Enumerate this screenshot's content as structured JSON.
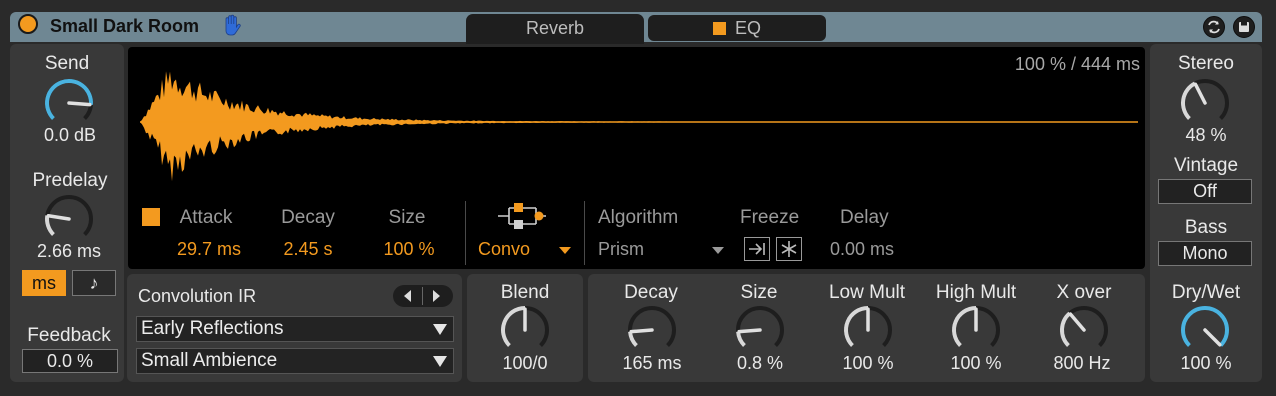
{
  "device": {
    "name": "Small Dark Room",
    "accent": "#f39a1f"
  },
  "tabs": [
    {
      "label": "Reverb"
    },
    {
      "label": "EQ"
    }
  ],
  "left": {
    "send": {
      "label": "Send",
      "value": "0.0 dB",
      "level": 0.85
    },
    "predelay": {
      "label": "Predelay",
      "value": "2.66 ms",
      "level": 0.2
    },
    "unit_ms": "ms",
    "unit_note": "♪",
    "feedback": {
      "label": "Feedback",
      "value": "0.0 %"
    }
  },
  "display": {
    "readout": "100 % / 444 ms",
    "attack": {
      "label": "Attack",
      "value": "29.7 ms"
    },
    "decay": {
      "label": "Decay",
      "value": "2.45 s"
    },
    "size": {
      "label": "Size",
      "value": "100 %"
    },
    "mode": "Convo",
    "algorithm": {
      "label": "Algorithm",
      "value": "Prism"
    },
    "freeze": {
      "label": "Freeze"
    },
    "delay": {
      "label": "Delay",
      "value": "0.00 ms"
    }
  },
  "ir": {
    "label": "Convolution IR",
    "category": "Early Reflections",
    "file": "Small Ambience"
  },
  "blend": {
    "label": "Blend",
    "value": "100/0",
    "level": 0.5
  },
  "bottom": {
    "decay": {
      "label": "Decay",
      "value": "165 ms",
      "level": 0.15
    },
    "size": {
      "label": "Size",
      "value": "0.8 %",
      "level": 0.15
    },
    "low_mult": {
      "label": "Low Mult",
      "value": "100 %",
      "level": 0.5
    },
    "high_mult": {
      "label": "High Mult",
      "value": "100 %",
      "level": 0.5
    },
    "xover": {
      "label": "X over",
      "value": "800 Hz",
      "level": 0.35
    }
  },
  "right": {
    "stereo": {
      "label": "Stereo",
      "value": "48 %",
      "level": 0.4
    },
    "vintage": {
      "label": "Vintage",
      "value": "Off"
    },
    "bass": {
      "label": "Bass",
      "value": "Mono"
    },
    "drywet": {
      "label": "Dry/Wet",
      "value": "100 %",
      "level": 1.0
    }
  }
}
